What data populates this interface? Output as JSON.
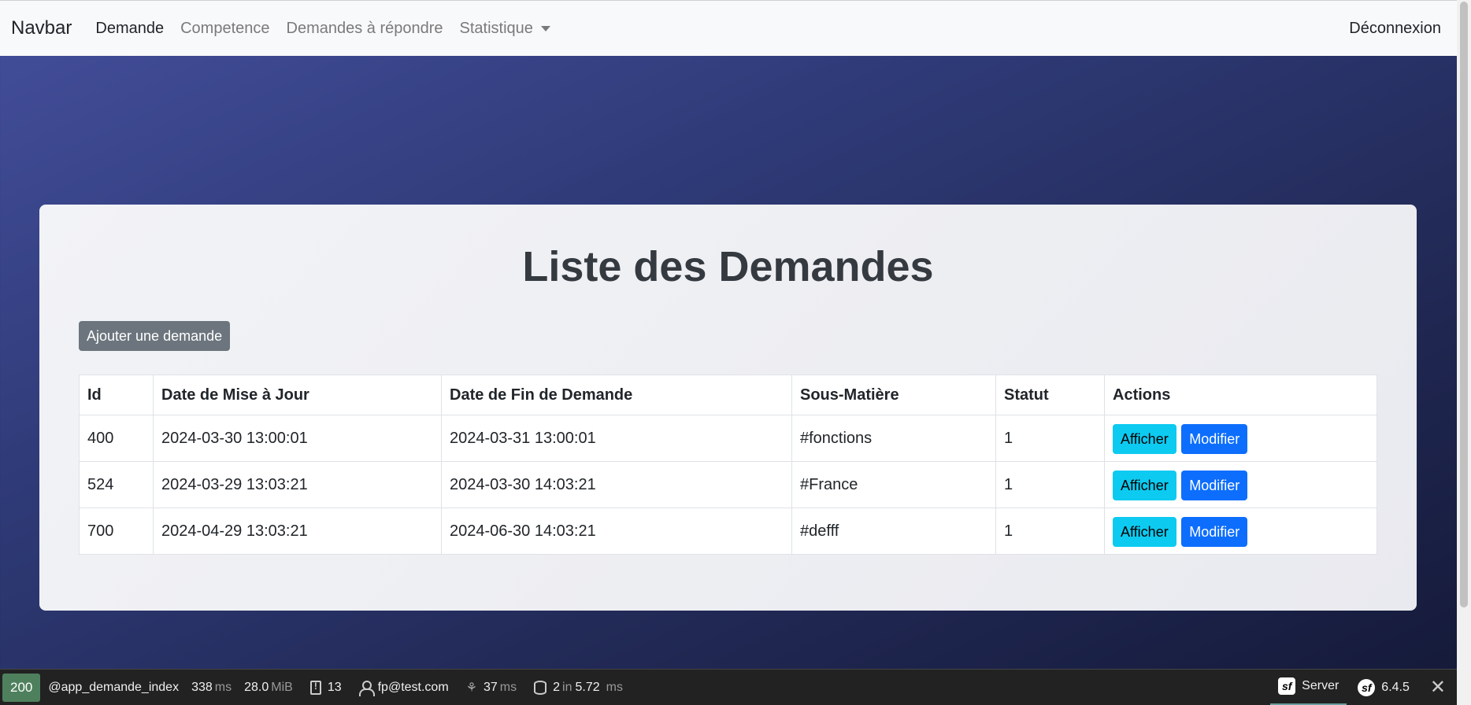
{
  "navbar": {
    "brand": "Navbar",
    "links": [
      "Demande",
      "Competence",
      "Demandes à répondre",
      "Statistique"
    ],
    "logout": "Déconnexion"
  },
  "card": {
    "title": "Liste des Demandes",
    "add_button": "Ajouter une demande"
  },
  "table": {
    "headers": [
      "Id",
      "Date de Mise à Jour",
      "Date de Fin de Demande",
      "Sous-Matière",
      "Statut",
      "Actions"
    ],
    "rows": [
      [
        "400",
        "2024-03-30 13:00:01",
        "2024-03-31 13:00:01",
        "#fonctions",
        "1"
      ],
      [
        "524",
        "2024-03-29 13:03:21",
        "2024-03-30 14:03:21",
        "#France",
        "1"
      ],
      [
        "700",
        "2024-04-29 13:03:21",
        "2024-06-30 14:03:21",
        "#defff",
        "1"
      ]
    ],
    "show_label": "Afficher",
    "edit_label": "Modifier"
  },
  "toolbar": {
    "status": "200",
    "route": "@app_demande_index",
    "time": "338",
    "time_unit": "ms",
    "memory": "28.0",
    "memory_unit": "MiB",
    "logs": "13",
    "user": "fp@test.com",
    "twig": "37",
    "twig_unit": "ms",
    "db_queries": "2",
    "db_in": "in",
    "db_time": "5.72",
    "db_unit": "ms",
    "server": "Server",
    "version": "6.4.5",
    "close": "✕"
  }
}
